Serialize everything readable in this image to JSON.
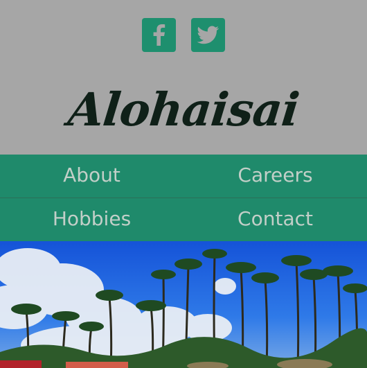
{
  "header": {
    "social": [
      {
        "name": "facebook",
        "icon": "facebook-icon"
      },
      {
        "name": "twitter",
        "icon": "twitter-icon"
      }
    ],
    "logo_text": "Alohaisai"
  },
  "nav": {
    "items": [
      {
        "label": "About"
      },
      {
        "label": "Careers"
      },
      {
        "label": "Hobbies"
      },
      {
        "label": "Contact"
      }
    ]
  },
  "hero": {
    "image": "palm-trees-beach-photo"
  },
  "colors": {
    "header_bg": "#a6a6a6",
    "accent": "#1f8a6b",
    "nav_text": "#c2cfc8",
    "logo_text": "#0f2018"
  }
}
